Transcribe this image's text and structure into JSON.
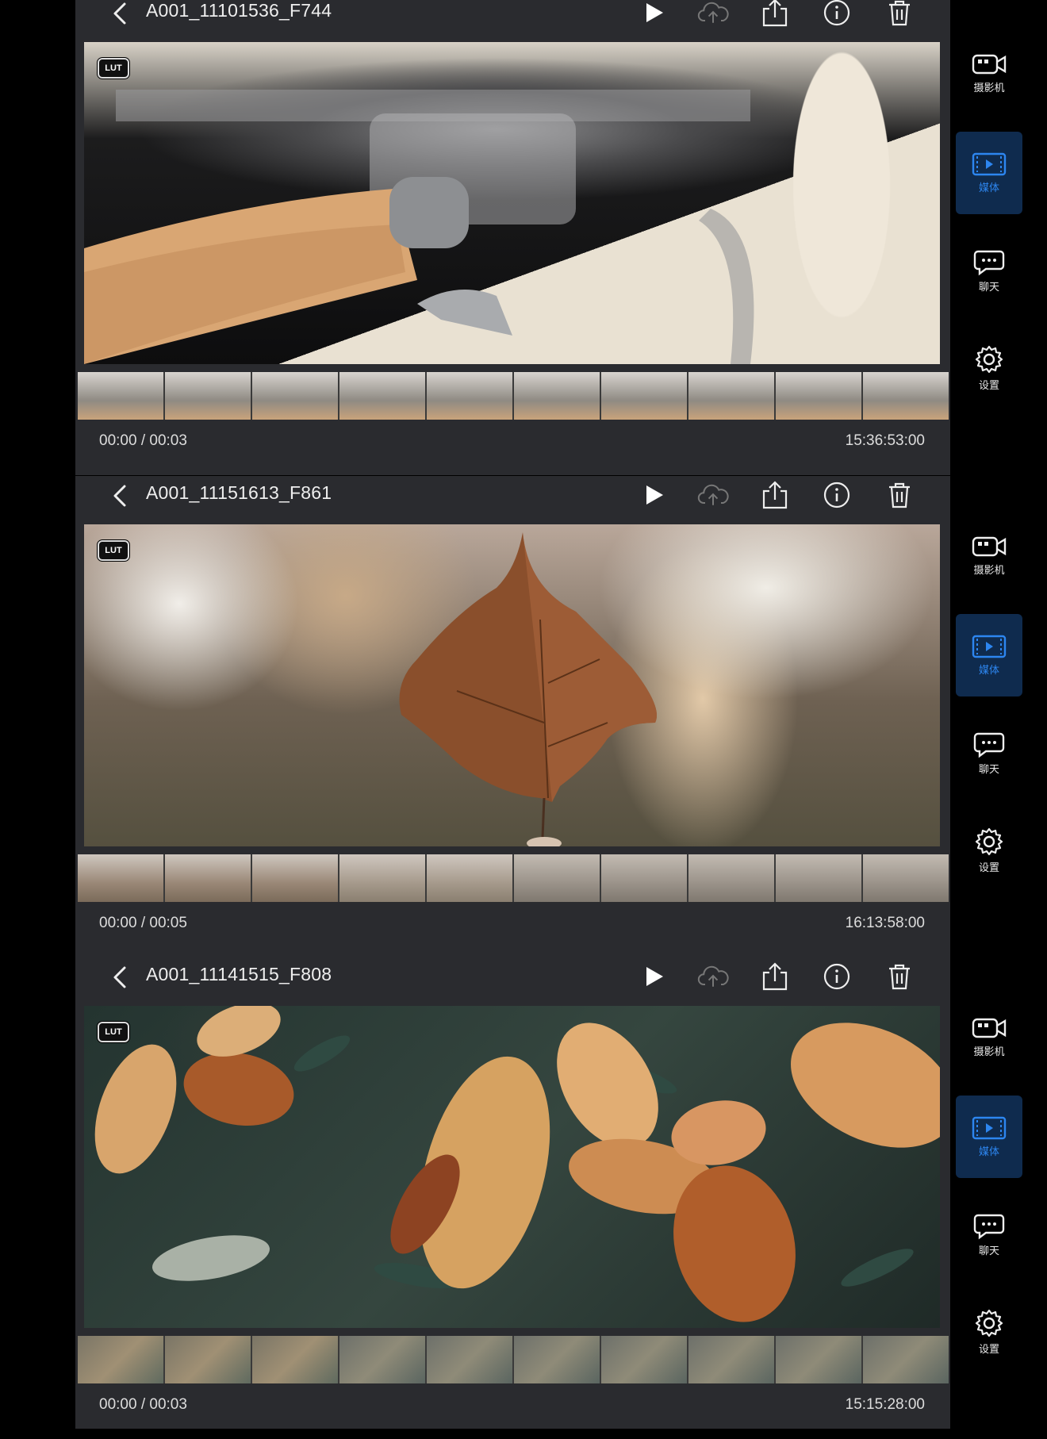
{
  "colors": {
    "panel_bg": "#2a2b2f",
    "accent": "#2d86f0",
    "active_bg": "#0f2b4e",
    "text": "#e6e6e6"
  },
  "clips": [
    {
      "title": "A001_11101536_F744",
      "badge": "LUT",
      "time": "00:00 / 00:03",
      "timestamp": "15:36:53:00"
    },
    {
      "title": "A001_11151613_F861",
      "badge": "LUT",
      "time": "00:00 / 00:05",
      "timestamp": "16:13:58:00"
    },
    {
      "title": "A001_11141515_F808",
      "badge": "LUT",
      "time": "00:00 / 00:03",
      "timestamp": "15:15:28:00"
    }
  ],
  "sidebar": {
    "items": [
      {
        "label": "摄影机",
        "icon": "camera-icon",
        "active": false
      },
      {
        "label": "媒体",
        "icon": "media-icon",
        "active": true
      },
      {
        "label": "聊天",
        "icon": "chat-icon",
        "active": false
      },
      {
        "label": "设置",
        "icon": "gear-icon",
        "active": false
      }
    ]
  },
  "icons": {
    "back": "chevron-left-icon",
    "play": "play-icon",
    "upload": "cloud-upload-icon",
    "share": "share-icon",
    "info": "info-icon",
    "delete": "trash-icon"
  }
}
